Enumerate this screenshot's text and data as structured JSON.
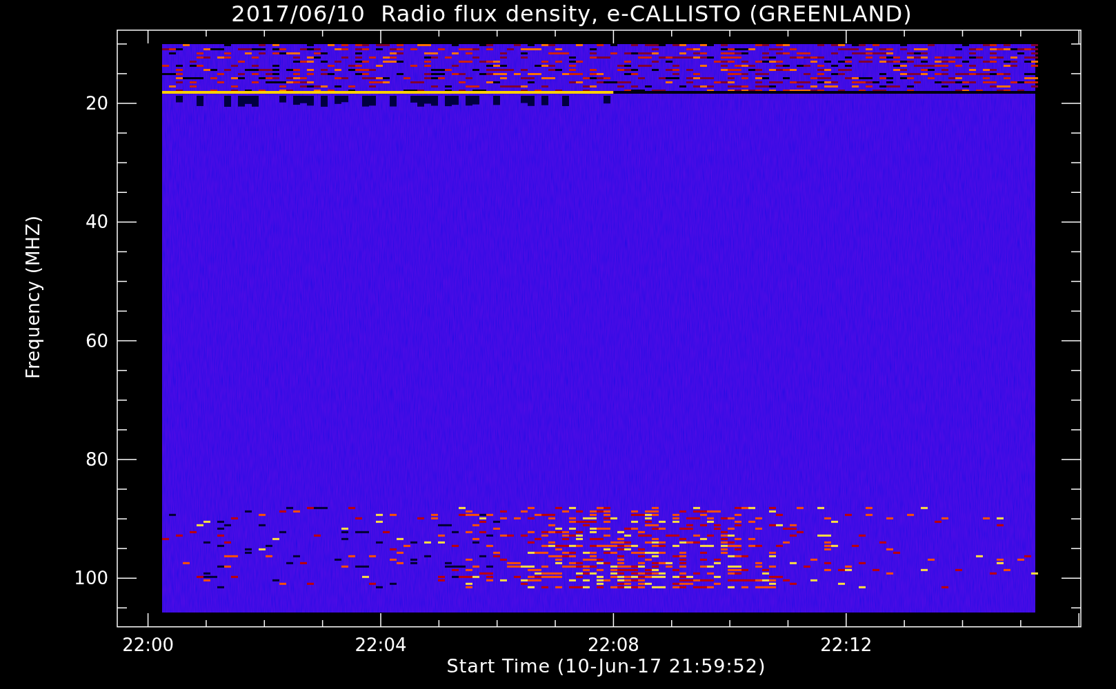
{
  "title": "2017/06/10  Radio flux density, e-CALLISTO (GREENLAND)",
  "y_axis": {
    "label": "Frequency (MHZ)",
    "ticks": [
      "20",
      "40",
      "60",
      "80",
      "100"
    ]
  },
  "x_axis": {
    "label": "Start Time (10-Jun-17 21:59:52)",
    "ticks": [
      "22:00",
      "22:04",
      "22:08",
      "22:12"
    ]
  }
}
